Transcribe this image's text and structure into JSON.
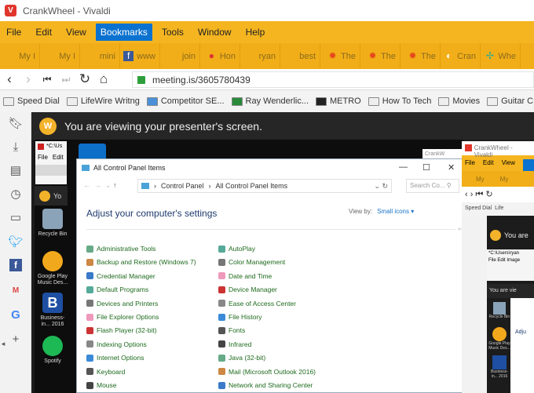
{
  "window": {
    "title": "CrankWheel - Vivaldi"
  },
  "menu": [
    "File",
    "Edit",
    "View",
    "Bookmarks",
    "Tools",
    "Window",
    "Help"
  ],
  "menu_active": "Bookmarks",
  "tabs": [
    {
      "label": "My I",
      "icon": ""
    },
    {
      "label": "My I",
      "icon": ""
    },
    {
      "label": "mini",
      "icon": ""
    },
    {
      "label": "www",
      "icon": "facebook-icon"
    },
    {
      "label": "join",
      "icon": ""
    },
    {
      "label": "Hon",
      "icon": "chrome-icon"
    },
    {
      "label": "ryan",
      "icon": ""
    },
    {
      "label": "best",
      "icon": ""
    },
    {
      "label": "The",
      "icon": "sun-icon"
    },
    {
      "label": "The",
      "icon": "sun-icon"
    },
    {
      "label": "The",
      "icon": "sun-icon"
    },
    {
      "label": "Cran",
      "icon": "crankwheel-icon"
    },
    {
      "label": "Whe",
      "icon": "slack-icon"
    }
  ],
  "address": {
    "url": "meeting.is/3605780439"
  },
  "bookmarks": [
    "Speed Dial",
    "LifeWire Writng",
    "Competitor SE...",
    "Ray Wenderlic...",
    "METRO",
    "How To Tech",
    "Movies",
    "Guitar C"
  ],
  "crankwheel": {
    "banner": "You are viewing your presenter's screen."
  },
  "desktop": {
    "icons": [
      "Recycle Bin",
      "Google Play Music Des...",
      "Business-in... 2016",
      "Spotify"
    ],
    "paint_title": "*C:\\Us",
    "paint_menu": [
      "File",
      "Edit"
    ],
    "banner_partial": "Yo"
  },
  "control_panel": {
    "title": "All Control Panel Items",
    "breadcrumb": [
      "Control Panel",
      "All Control Panel Items"
    ],
    "search_placeholder": "Search Co...",
    "heading": "Adjust your computer's settings",
    "view_by_label": "View by:",
    "view_by_value": "Small icons ▾",
    "col1": [
      "Administrative Tools",
      "Backup and Restore (Windows 7)",
      "Credential Manager",
      "Default Programs",
      "Devices and Printers",
      "File Explorer Options",
      "Flash Player (32-bit)",
      "Indexing Options",
      "Internet Options",
      "Keyboard",
      "Mouse"
    ],
    "col2": [
      "AutoPlay",
      "Color Management",
      "Date and Time",
      "Device Manager",
      "Ease of Access Center",
      "File History",
      "Fonts",
      "Infrared",
      "Java (32-bit)",
      "Mail (Microsoft Outlook 2016)",
      "Network and Sharing Center"
    ]
  },
  "nested": {
    "title": "CrankWheel - Vivaldi",
    "menu": [
      "File",
      "Edit",
      "View"
    ],
    "tabs": [
      "My",
      "My"
    ],
    "bookmark": "Speed Dial",
    "bookmark2": "Life",
    "banner": "You are",
    "paint_title": "*C:\\Users\\ryan",
    "paint_menu": [
      "File",
      "Edit",
      "Image"
    ],
    "banner2": "You are vie",
    "icons": [
      "Recycle Bin",
      "Google Play Music Des...",
      "Business-in... 2016"
    ],
    "cp_heading": "Adju"
  }
}
